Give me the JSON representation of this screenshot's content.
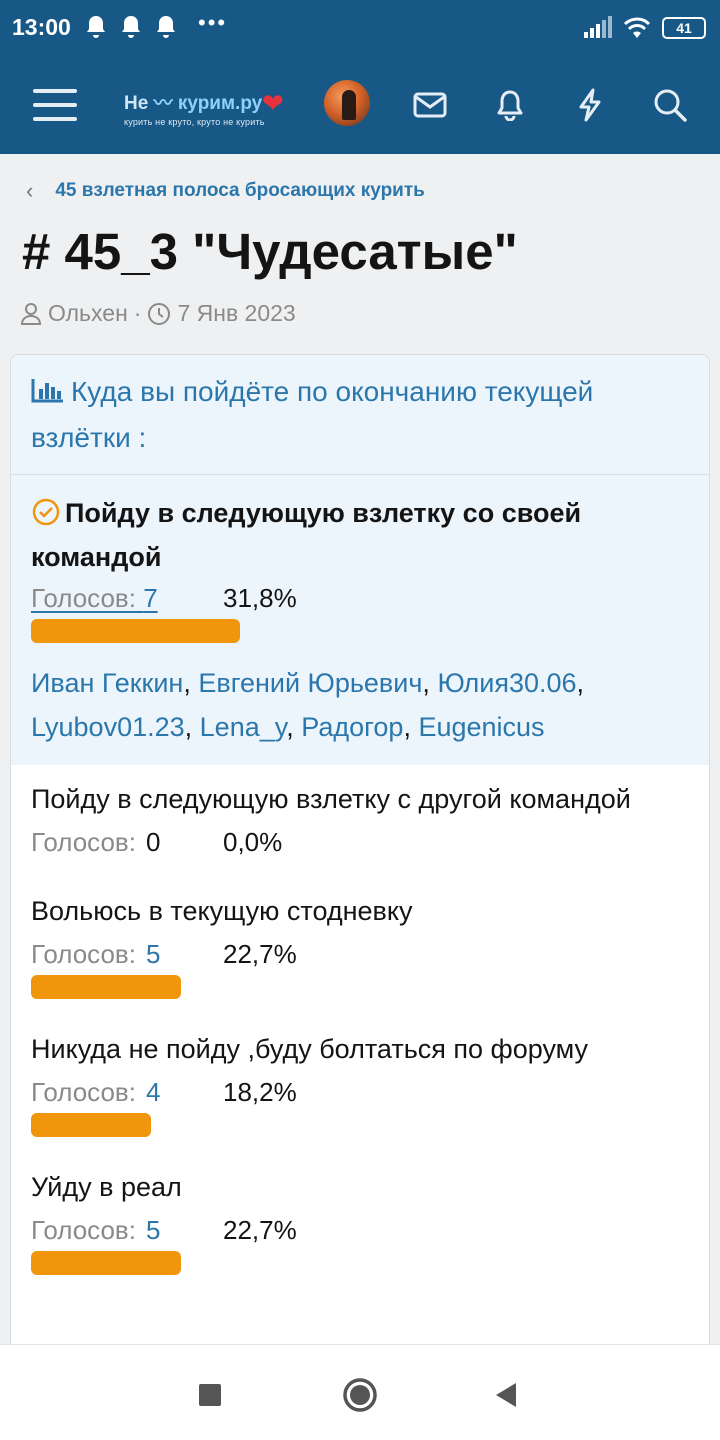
{
  "status_bar": {
    "time": "13:00",
    "battery": "41",
    "icons": [
      "bell-icon",
      "bell-icon",
      "bell-icon",
      "more-dots",
      "signal-icon",
      "wifi-icon",
      "battery-icon"
    ]
  },
  "header": {
    "logo_main": "Не",
    "logo_accent": "курим.ру",
    "logo_tagline": "курить не круто, круто не курить",
    "icons": [
      "menu-icon",
      "logo",
      "avatar",
      "mail-icon",
      "bell-icon",
      "lightning-icon",
      "search-icon"
    ]
  },
  "breadcrumb": {
    "label": "45 взлетная полоса бросающих курить"
  },
  "thread": {
    "title": "# 45_3 \"Чудесатые\"",
    "author": "Ольхен",
    "separator": "·",
    "date": "7 Янв 2023"
  },
  "poll": {
    "question": "Куда вы пойдёте по окончанию текущей взлётки :",
    "votes_label": "Голосов:",
    "responses": [
      {
        "label": "Пойду в следующую взлетку со своей командой",
        "votes": "7",
        "percent": "31,8%",
        "share": 0.318,
        "voted": true
      },
      {
        "label": "Пойду в следующую взлетку с другой командой",
        "votes": "0",
        "percent": "0,0%",
        "share": 0.0,
        "voted": false
      },
      {
        "label": "Вольюсь в текущую стодневку",
        "votes": "5",
        "percent": "22,7%",
        "share": 0.227,
        "voted": false
      },
      {
        "label": "Никуда не пойду ,буду болтаться по форуму",
        "votes": "4",
        "percent": "18,2%",
        "share": 0.182,
        "voted": false
      },
      {
        "label": "Уйду в реал",
        "votes": "5",
        "percent": "22,7%",
        "share": 0.227,
        "voted": false
      }
    ],
    "voters": [
      "Иван Геккин",
      "Евгений Юрьевич",
      "Юлия30.06",
      "Lyubov01.23",
      "Lena_y",
      "Радогор",
      "Eugenicus"
    ],
    "bar_color": "#f0960c"
  },
  "colors": {
    "header": "#185886",
    "link": "#2b77ab",
    "check": "#f0960c"
  },
  "nav": {
    "icons": [
      "recents-square-icon",
      "home-circle-icon",
      "back-triangle-icon"
    ]
  }
}
